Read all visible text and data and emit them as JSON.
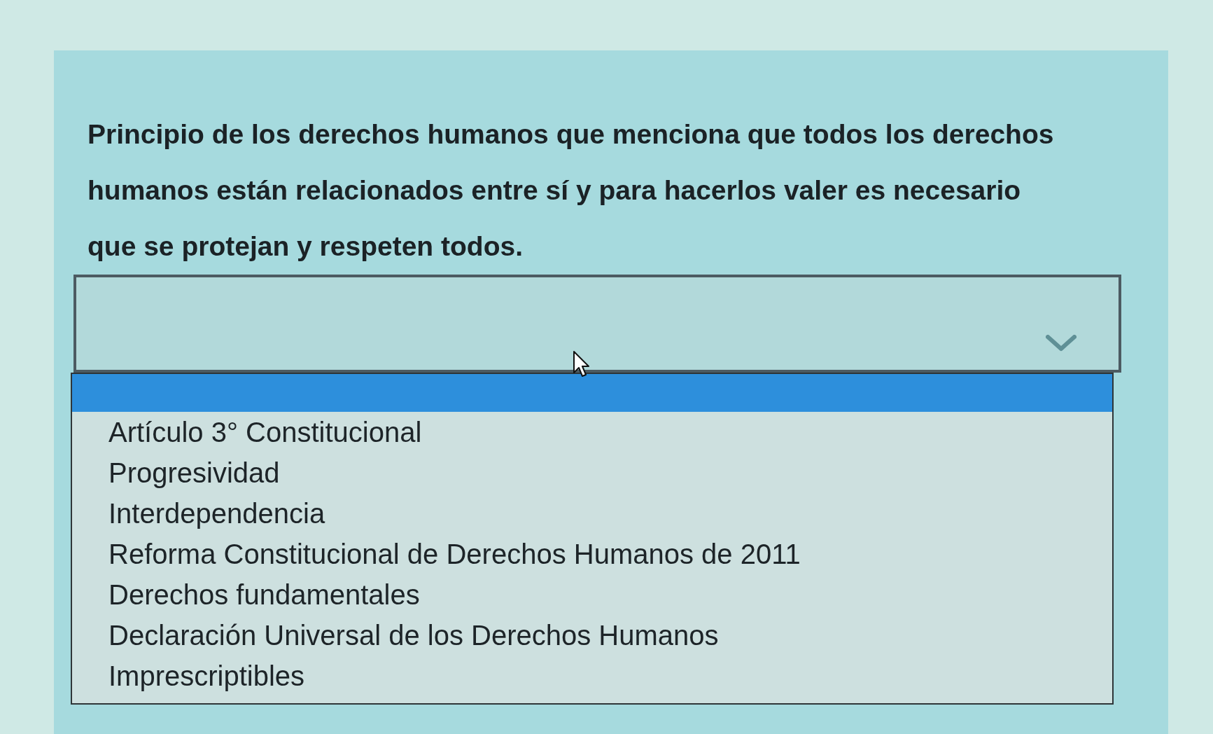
{
  "question": {
    "text": "Principio de los derechos humanos que menciona que todos los derechos humanos están relacionados entre sí y para hacerlos valer es necesario que se protejan y respeten todos."
  },
  "select": {
    "open": true,
    "options": [
      {
        "selected": true
      },
      {
        "label": "Artículo 3° Constitucional",
        "selected": false
      },
      {
        "label": "Progresividad",
        "selected": false
      },
      {
        "label": "Interdependencia",
        "selected": false
      },
      {
        "label": "Reforma Constitucional de Derechos Humanos de 2011",
        "selected": false
      },
      {
        "label": "Derechos fundamentales",
        "selected": false
      },
      {
        "label": "Declaración Universal de los Derechos Humanos",
        "selected": false
      },
      {
        "label": "Imprescriptibles",
        "selected": false
      }
    ]
  }
}
